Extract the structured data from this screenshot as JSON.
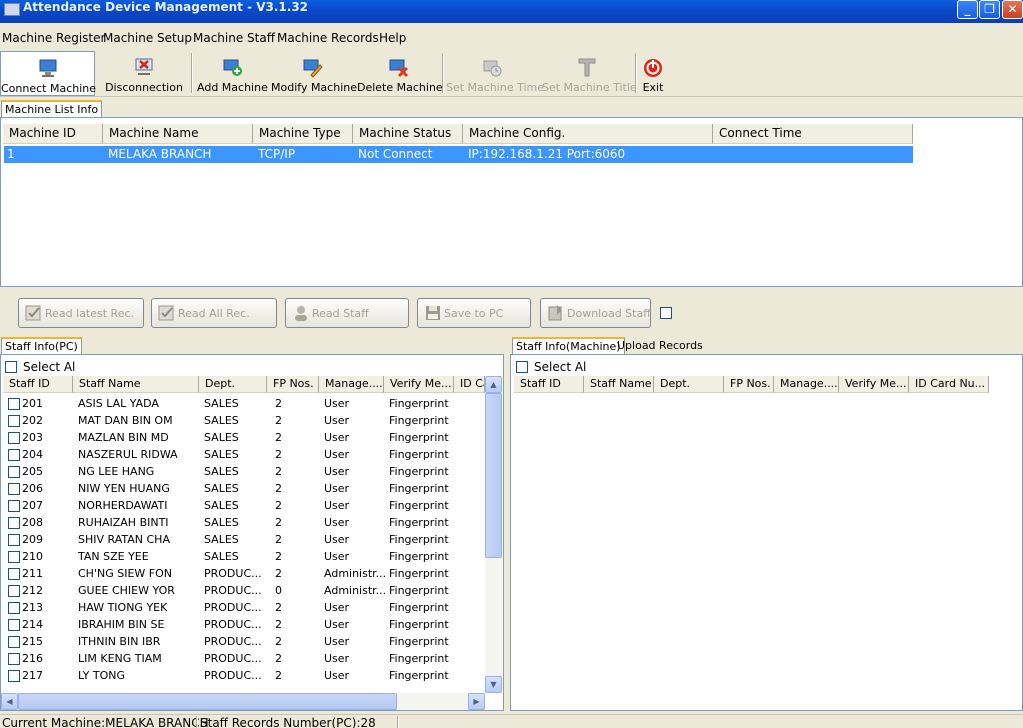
{
  "window": {
    "title": "Attendance Device Management - V3.1.32"
  },
  "menu": [
    "Machine Register",
    "Machine Setup",
    "Machine Staff",
    "Machine Records",
    "Help"
  ],
  "toolbar": {
    "connect": "Connect Machine",
    "disconnect": "Disconnection",
    "add": "Add Machine",
    "modify": "Modify Machine",
    "delete": "Delete Machine",
    "set_time": "Set Machine Time",
    "set_title": "Set Machine Title",
    "exit": "Exit"
  },
  "machine_list": {
    "tab": "Machine List Info",
    "columns": [
      "Machine ID",
      "Machine Name",
      "Machine Type",
      "Machine Status",
      "Machine Config.",
      "Connect Time"
    ],
    "rows": [
      {
        "id": "1",
        "name": "MELAKA BRANCH",
        "type": "TCP/IP",
        "status": "Not Connect",
        "config": "IP:192.168.1.21 Port:6060",
        "connect_time": ""
      }
    ]
  },
  "actions": {
    "read_latest": "Read latest Rec.",
    "read_all": "Read All Rec.",
    "read_staff": "Read Staff",
    "save_pc": "Save to PC",
    "download_staff": "Download Staff"
  },
  "staff_pc": {
    "tab": "Staff Info(PC)",
    "select_all": "Select Al",
    "columns": [
      "Staff ID",
      "Staff Name",
      "Dept.",
      "FP Nos.",
      "Manage....",
      "Verify Me...",
      "ID Ca"
    ],
    "rows": [
      {
        "id": "201",
        "name": "ASIS LAL YADA",
        "dept": "SALES",
        "fp": "2",
        "manage": "User",
        "verify": "Fingerprint"
      },
      {
        "id": "202",
        "name": "MAT DAN BIN OM",
        "dept": "SALES",
        "fp": "2",
        "manage": "User",
        "verify": "Fingerprint"
      },
      {
        "id": "203",
        "name": "MAZLAN BIN MD",
        "dept": "SALES",
        "fp": "2",
        "manage": "User",
        "verify": "Fingerprint"
      },
      {
        "id": "204",
        "name": "NASZERUL RIDWA",
        "dept": "SALES",
        "fp": "2",
        "manage": "User",
        "verify": "Fingerprint"
      },
      {
        "id": "205",
        "name": "NG LEE HANG",
        "dept": "SALES",
        "fp": "2",
        "manage": "User",
        "verify": "Fingerprint"
      },
      {
        "id": "206",
        "name": "NIW YEN HUANG",
        "dept": "SALES",
        "fp": "2",
        "manage": "User",
        "verify": "Fingerprint"
      },
      {
        "id": "207",
        "name": "NORHERDAWATI",
        "dept": "SALES",
        "fp": "2",
        "manage": "User",
        "verify": "Fingerprint"
      },
      {
        "id": "208",
        "name": "RUHAIZAH BINTI",
        "dept": "SALES",
        "fp": "2",
        "manage": "User",
        "verify": "Fingerprint"
      },
      {
        "id": "209",
        "name": "SHIV RATAN CHA",
        "dept": "SALES",
        "fp": "2",
        "manage": "User",
        "verify": "Fingerprint"
      },
      {
        "id": "210",
        "name": "TAN SZE YEE",
        "dept": "SALES",
        "fp": "2",
        "manage": "User",
        "verify": "Fingerprint"
      },
      {
        "id": "211",
        "name": "CH'NG SIEW FON",
        "dept": "PRODUC...",
        "fp": "2",
        "manage": "Administr...",
        "verify": "Fingerprint"
      },
      {
        "id": "212",
        "name": "GUEE CHIEW YOR",
        "dept": "PRODUC...",
        "fp": "0",
        "manage": "Administr...",
        "verify": "Fingerprint"
      },
      {
        "id": "213",
        "name": "HAW TIONG YEK",
        "dept": "PRODUC...",
        "fp": "2",
        "manage": "User",
        "verify": "Fingerprint"
      },
      {
        "id": "214",
        "name": "IBRAHIM BIN SE",
        "dept": "PRODUC...",
        "fp": "2",
        "manage": "User",
        "verify": "Fingerprint"
      },
      {
        "id": "215",
        "name": "ITHNIN BIN IBR",
        "dept": "PRODUC...",
        "fp": "2",
        "manage": "User",
        "verify": "Fingerprint"
      },
      {
        "id": "216",
        "name": "LIM KENG TIAM",
        "dept": "PRODUC...",
        "fp": "2",
        "manage": "User",
        "verify": "Fingerprint"
      },
      {
        "id": "217",
        "name": "LY TONG",
        "dept": "PRODUC...",
        "fp": "2",
        "manage": "User",
        "verify": "Fingerprint"
      }
    ]
  },
  "staff_machine": {
    "tab": "Staff Info(Machine)",
    "tab2": "Upload Records",
    "select_all": "Select Al",
    "columns": [
      "Staff ID",
      "Staff Name",
      "Dept.",
      "FP Nos.",
      "Manage....",
      "Verify Me...",
      "ID Card Nu..."
    ]
  },
  "status": {
    "current_machine": "Current Machine:MELAKA BRANCH",
    "records": "Staff Records Number(PC):28"
  },
  "colors": {
    "selection": "#3d95ff",
    "titlebar": "#0a48c8",
    "tab_accent": "#f4b433"
  }
}
